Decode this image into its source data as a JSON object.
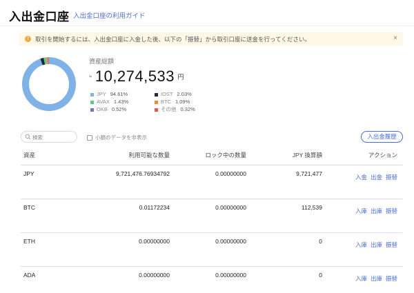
{
  "header": {
    "title": "入出金口座",
    "guide_link": "入出金口座の利用ガイド"
  },
  "notice": {
    "icon": "warning-icon",
    "text": "取引を開始するには、入出金口座に入金した後、以下の「振替」から取引口座に送金を行ってください。",
    "close_label": "×"
  },
  "summary": {
    "label": "資産総額",
    "approx": "≈",
    "total": "10,274,533",
    "unit": "円",
    "breakdown": [
      {
        "asset": "JPY",
        "percent": "94.61%",
        "value": 94.61,
        "color": "#7fb3e8"
      },
      {
        "asset": "IOST",
        "percent": "2.03%",
        "value": 2.03,
        "color": "#1c2b3a"
      },
      {
        "asset": "AVAX",
        "percent": "1.43%",
        "value": 1.43,
        "color": "#5ecb8a"
      },
      {
        "asset": "BTC",
        "percent": "1.09%",
        "value": 1.09,
        "color": "#f28a30"
      },
      {
        "asset": "OKB",
        "percent": "0.52%",
        "value": 0.52,
        "color": "#7b6fd6"
      },
      {
        "asset": "その他",
        "percent": "0.32%",
        "value": 0.32,
        "color": "#f0524a"
      }
    ]
  },
  "toolbar": {
    "search_placeholder": "検索",
    "hide_small_label": "小額のデータを非表示",
    "history_button": "入出金履歴"
  },
  "table": {
    "headers": {
      "asset": "資産",
      "available": "利用可能な数量",
      "locked": "ロック中の数量",
      "jpy_value": "JPY 換算額",
      "actions": "アクション"
    },
    "rows": [
      {
        "asset": "JPY",
        "available": "9,721,476.76934792",
        "locked": "0.00000000",
        "jpy_value": "9,721,477",
        "actions": [
          "入金",
          "出金",
          "振替"
        ]
      },
      {
        "asset": "BTC",
        "available": "0.01172234",
        "locked": "0.00000000",
        "jpy_value": "112,539",
        "actions": [
          "入庫",
          "出庫",
          "振替"
        ]
      },
      {
        "asset": "ETH",
        "available": "0.00000000",
        "locked": "0.00000000",
        "jpy_value": "0",
        "actions": [
          "入庫",
          "出庫",
          "振替"
        ]
      },
      {
        "asset": "ADA",
        "available": "0.00000000",
        "locked": "0.00000000",
        "jpy_value": "0",
        "actions": [
          "入庫",
          "出庫",
          "振替"
        ]
      }
    ]
  }
}
